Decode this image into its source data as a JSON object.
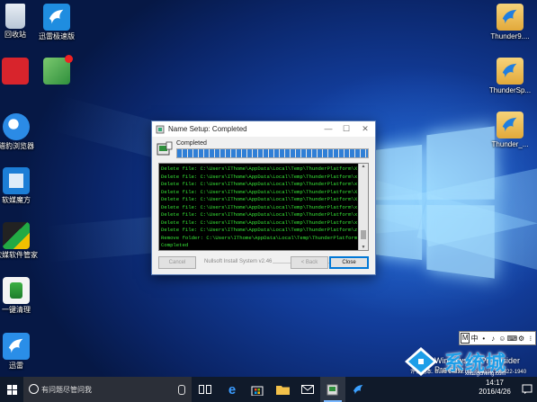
{
  "desktop_icons": [
    {
      "label": "回收站",
      "icon": "recycle-bin-icon"
    },
    {
      "label": "迅雷极速版",
      "icon": "thunder-bird-icon"
    },
    {
      "label": "",
      "icon": "red-app-icon"
    },
    {
      "label": "",
      "icon": "green-app-icon"
    },
    {
      "label": "猎豹浏览器",
      "icon": "browser-icon"
    },
    {
      "label": "软媒魔方",
      "icon": "cube-icon"
    },
    {
      "label": "软媒软件管家",
      "icon": "software-manager-icon"
    },
    {
      "label": "一键清理",
      "icon": "cleanup-icon"
    },
    {
      "label": "迅雷",
      "icon": "thunder-bird-icon"
    },
    {
      "label": "Thunder9....",
      "icon": "thunder-file-icon"
    },
    {
      "label": "ThunderSp...",
      "icon": "thunder-file-icon"
    },
    {
      "label": "Thunder_...",
      "icon": "thunder-file-icon"
    }
  ],
  "dialog": {
    "title": "Name Setup: Completed",
    "progress_label": "Completed",
    "progress_fraction": 1.0,
    "log_lines": [
      "Delete file: C:\\Users\\IThome\\AppData\\Local\\Temp\\ThunderPlatform\\XLCry...",
      "Delete file: C:\\Users\\IThome\\AppData\\Local\\Temp\\ThunderPlatform\\xldc.dll",
      "Delete file: C:\\Users\\IThome\\AppData\\Local\\Temp\\ThunderPlatform\\xldcca...",
      "Delete file: C:\\Users\\IThome\\AppData\\Local\\Temp\\ThunderPlatform\\XLFSI...",
      "Delete file: C:\\Users\\IThome\\AppData\\Local\\Temp\\ThunderPlatform\\XLLua...",
      "Delete file: C:\\Users\\IThome\\AppData\\Local\\Temp\\ThunderPlatform\\xl_die...",
      "Delete file: C:\\Users\\IThome\\AppData\\Local\\Temp\\ThunderPlatform\\xl_dat...",
      "Delete file: C:\\Users\\IThome\\AppData\\Local\\Temp\\ThunderPlatform\\xl_dat...",
      "Delete file: C:\\Users\\IThome\\AppData\\Local\\Temp\\ThunderPlatform\\zlib1.dll",
      "Remove folder: C:\\Users\\IThome\\AppData\\Local\\Temp\\ThunderPlatform\\",
      "Completed"
    ],
    "cancel_label": "Cancel",
    "branding": "Nullsoft Install System v2.46",
    "back_label": "< Back",
    "close_label": "Close"
  },
  "ime_bar": {
    "mode": "M",
    "items": [
      "中",
      "•",
      "♪",
      "☺",
      "⌨",
      "⚙",
      "⁝"
    ]
  },
  "watermark": {
    "line1": "Windows 10 Pro Insider Preview",
    "line2": "评估副本. Build 14332.rs1_release.160422-1940",
    "brand": "系统城",
    "brand_sub": "xitongcheng.com"
  },
  "taskbar": {
    "search_placeholder": "有问题尽管问我",
    "time": "14:17",
    "date": "2016/4/26"
  }
}
